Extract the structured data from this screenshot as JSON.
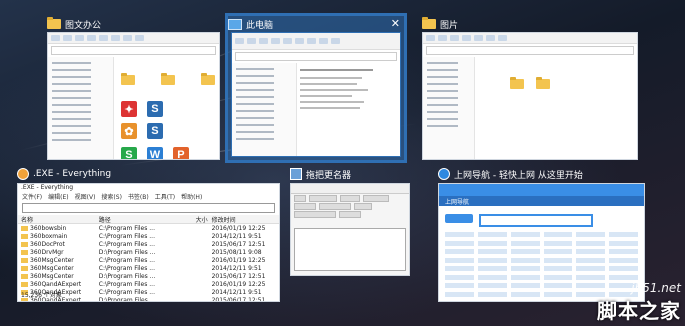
{
  "windows": [
    {
      "title": "图文办公",
      "icon": "folder-icon"
    },
    {
      "title": "此电脑",
      "icon": "this-pc-icon"
    },
    {
      "title": "图片",
      "icon": "folder-icon"
    },
    {
      "title": ".EXE - Everything",
      "icon": "everything-search-icon"
    },
    {
      "title": "拖把更名器",
      "icon": "rename-tool-icon"
    },
    {
      "title": "上网导航 - 轻快上网 从这里开始",
      "icon": "browser-icon"
    }
  ],
  "close_glyph": "✕",
  "everything": {
    "window_title": ".EXE - Everything",
    "menu": [
      "文件(F)",
      "编辑(E)",
      "视图(V)",
      "搜索(S)",
      "书签(B)",
      "工具(T)",
      "帮助(H)"
    ],
    "columns": [
      "名称",
      "路径",
      "大小",
      "修改时间"
    ],
    "rows": [
      [
        "360bowsbin",
        "C:\\Program Files ...",
        "",
        "2016/01/19 12:25"
      ],
      [
        "360boxmain",
        "C:\\Program Files ...",
        "",
        "2014/12/11 9:51"
      ],
      [
        "360DocProt",
        "C:\\Program Files ...",
        "",
        "2015/06/17 12:51"
      ],
      [
        "360DrvMgr",
        "D:\\Program Files ...",
        "",
        "2015/08/11 9:08"
      ],
      [
        "360MsgCenter",
        "C:\\Program Files ...",
        "",
        "2016/01/19 12:25"
      ],
      [
        "360MsgCenter",
        "C:\\Program Files ...",
        "",
        "2014/12/11 9:51"
      ],
      [
        "360MsgCenter",
        "D:\\Program Files ...",
        "",
        "2015/06/17 12:51"
      ],
      [
        "360QandAExpert",
        "C:\\Program Files ...",
        "",
        "2016/01/19 12:25"
      ],
      [
        "360QandAExpert",
        "C:\\Program Files ...",
        "",
        "2014/12/11 9:51"
      ],
      [
        "360QandAExpert",
        "D:\\Program Files ...",
        "",
        "2015/06/17 12:51"
      ]
    ],
    "status": "15,236 个对象"
  },
  "browser": {
    "logo_text": "上网导航"
  },
  "watermark": {
    "site": "jb51.net",
    "name": "脚本之家"
  }
}
